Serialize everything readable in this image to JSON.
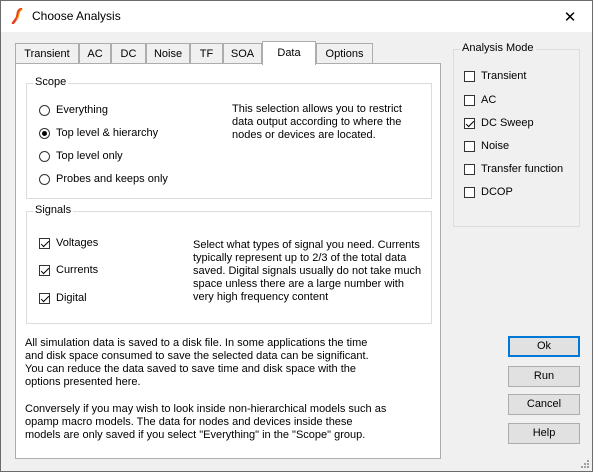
{
  "window": {
    "title": "Choose Analysis",
    "close_glyph": "✕",
    "icon": "simulator-app-icon"
  },
  "tabs": [
    {
      "label": "Transient",
      "active": false
    },
    {
      "label": "AC",
      "active": false
    },
    {
      "label": "DC",
      "active": false
    },
    {
      "label": "Noise",
      "active": false
    },
    {
      "label": "TF",
      "active": false
    },
    {
      "label": "SOA",
      "active": false
    },
    {
      "label": "Data",
      "active": true
    },
    {
      "label": "Options",
      "active": false
    }
  ],
  "scope": {
    "label": "Scope",
    "options": [
      {
        "label": "Everything",
        "selected": false
      },
      {
        "label": "Top level & hierarchy",
        "selected": true
      },
      {
        "label": "Top level only",
        "selected": false
      },
      {
        "label": "Probes and keeps only",
        "selected": false
      }
    ],
    "description": [
      "This selection allows you to restrict",
      "data output according to where the",
      "nodes or devices are located."
    ]
  },
  "signals": {
    "label": "Signals",
    "options": [
      {
        "label": "Voltages",
        "checked": true
      },
      {
        "label": "Currents",
        "checked": true
      },
      {
        "label": "Digital",
        "checked": true
      }
    ],
    "description": [
      "Select what types of signal you need. Currents",
      "typically represent up to 2/3 of the total data",
      "saved. Digital signals usually do not take much",
      "space unless there are a large number with",
      "very high frequency content"
    ]
  },
  "info": {
    "paragraph1": [
      "All simulation data is saved to a disk file. In some applications the time",
      "and disk space consumed to save the selected data can be significant.",
      "You can reduce the data saved to save time and disk space with the",
      "options presented here."
    ],
    "paragraph2": [
      "Conversely if you may wish to look inside non-hierarchical models such as",
      "opamp macro models. The data for nodes and devices inside these",
      "models are only saved if you select \"Everything\" in the \"Scope\" group."
    ]
  },
  "analysis_mode": {
    "label": "Analysis Mode",
    "options": [
      {
        "label": "Transient",
        "checked": false
      },
      {
        "label": "AC",
        "checked": false
      },
      {
        "label": "DC Sweep",
        "checked": true
      },
      {
        "label": "Noise",
        "checked": false
      },
      {
        "label": "Transfer function",
        "checked": false
      },
      {
        "label": "DCOP",
        "checked": false
      }
    ]
  },
  "buttons": {
    "ok": "Ok",
    "run": "Run",
    "cancel": "Cancel",
    "help": "Help"
  }
}
